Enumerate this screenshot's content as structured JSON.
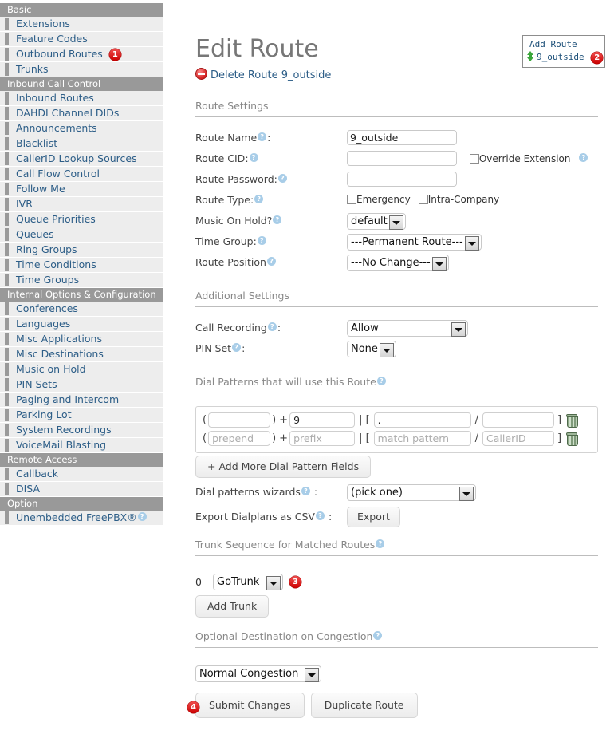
{
  "sidebar": {
    "groups": [
      {
        "section": "Basic",
        "items": [
          {
            "label": "Extensions",
            "badge": null
          },
          {
            "label": "Feature Codes",
            "badge": null
          },
          {
            "label": "Outbound Routes",
            "badge": "1"
          },
          {
            "label": "Trunks",
            "badge": null
          }
        ]
      },
      {
        "section": "Inbound Call Control",
        "items": [
          {
            "label": "Inbound Routes",
            "badge": null
          },
          {
            "label": "DAHDI Channel DIDs",
            "badge": null
          },
          {
            "label": "Announcements",
            "badge": null
          },
          {
            "label": "Blacklist",
            "badge": null
          },
          {
            "label": "CallerID Lookup Sources",
            "badge": null
          },
          {
            "label": "Call Flow Control",
            "badge": null
          },
          {
            "label": "Follow Me",
            "badge": null
          },
          {
            "label": "IVR",
            "badge": null
          },
          {
            "label": "Queue Priorities",
            "badge": null
          },
          {
            "label": "Queues",
            "badge": null
          },
          {
            "label": "Ring Groups",
            "badge": null
          },
          {
            "label": "Time Conditions",
            "badge": null
          },
          {
            "label": "Time Groups",
            "badge": null
          }
        ]
      },
      {
        "section": "Internal Options & Configuration",
        "items": [
          {
            "label": "Conferences",
            "badge": null
          },
          {
            "label": "Languages",
            "badge": null
          },
          {
            "label": "Misc Applications",
            "badge": null
          },
          {
            "label": "Misc Destinations",
            "badge": null
          },
          {
            "label": "Music on Hold",
            "badge": null
          },
          {
            "label": "PIN Sets",
            "badge": null
          },
          {
            "label": "Paging and Intercom",
            "badge": null
          },
          {
            "label": "Parking Lot",
            "badge": null
          },
          {
            "label": "System Recordings",
            "badge": null
          },
          {
            "label": "VoiceMail Blasting",
            "badge": null
          }
        ]
      },
      {
        "section": "Remote Access",
        "items": [
          {
            "label": "Callback",
            "badge": null
          },
          {
            "label": "DISA",
            "badge": null
          }
        ]
      },
      {
        "section": "Option",
        "items": [
          {
            "label": "Unembedded FreePBX®",
            "badge": null,
            "help": true
          }
        ]
      }
    ]
  },
  "add_route_panel": {
    "title": "Add Route",
    "routes": [
      {
        "label": "9_outside",
        "badge": "2"
      }
    ]
  },
  "main": {
    "page_title": "Edit Route",
    "delete_link": "Delete Route 9_outside",
    "sections": {
      "route_settings": "Route Settings",
      "additional_settings": "Additional Settings",
      "dial_patterns": "Dial Patterns that will use this Route",
      "trunk_sequence": "Trunk Sequence for Matched Routes",
      "optional_destination": "Optional Destination on Congestion"
    },
    "fields": {
      "route_name": {
        "label": "Route Name",
        "value": "9_outside"
      },
      "route_cid": {
        "label": "Route CID",
        "value": ""
      },
      "override_extension": {
        "label": "Override Extension",
        "checked": false
      },
      "route_password": {
        "label": "Route Password:",
        "value": ""
      },
      "route_type": {
        "label": "Route Type:",
        "options": [
          {
            "label": "Emergency",
            "checked": false
          },
          {
            "label": "Intra-Company",
            "checked": false
          }
        ]
      },
      "music_on_hold": {
        "label": "Music On Hold?",
        "value": "default"
      },
      "time_group": {
        "label": "Time Group:",
        "value": "---Permanent Route---"
      },
      "route_position": {
        "label": "Route Position",
        "value": "---No Change---"
      },
      "call_recording": {
        "label": "Call Recording",
        "value": "Allow"
      },
      "pin_set": {
        "label": "PIN Set",
        "value": "None"
      },
      "dial_patterns_wizards": {
        "label": "Dial patterns wizards",
        "value": "(pick one)"
      },
      "export_csv": {
        "label": "Export Dialplans as CSV",
        "button": "Export"
      },
      "congestion_destination": {
        "value": "Normal Congestion"
      }
    },
    "dial_pattern_rows": [
      {
        "prepend": "",
        "prepend_placeholder": "",
        "prefix": "9",
        "prefix_placeholder": "",
        "match": ".",
        "match_placeholder": "",
        "cid": "",
        "cid_placeholder": ""
      },
      {
        "prepend": "",
        "prepend_placeholder": "prepend",
        "prefix": "",
        "prefix_placeholder": "prefix",
        "match": "",
        "match_placeholder": "match pattern",
        "cid": "",
        "cid_placeholder": "CallerID"
      }
    ],
    "buttons": {
      "add_more_dial_pattern": "+ Add More Dial Pattern Fields",
      "add_trunk": "Add Trunk",
      "submit_changes": "Submit Changes",
      "duplicate_route": "Duplicate Route"
    },
    "trunk_sequence": [
      {
        "index": "0",
        "value": "GoTrunk",
        "badge": "3"
      }
    ],
    "submit_badge": "4"
  },
  "colors": {
    "link": "#2c5d87",
    "section_header_bg": "#999999",
    "nav_item_bg": "#ededed",
    "badge_red": "#d42020",
    "help_blue": "#a8cde8"
  }
}
